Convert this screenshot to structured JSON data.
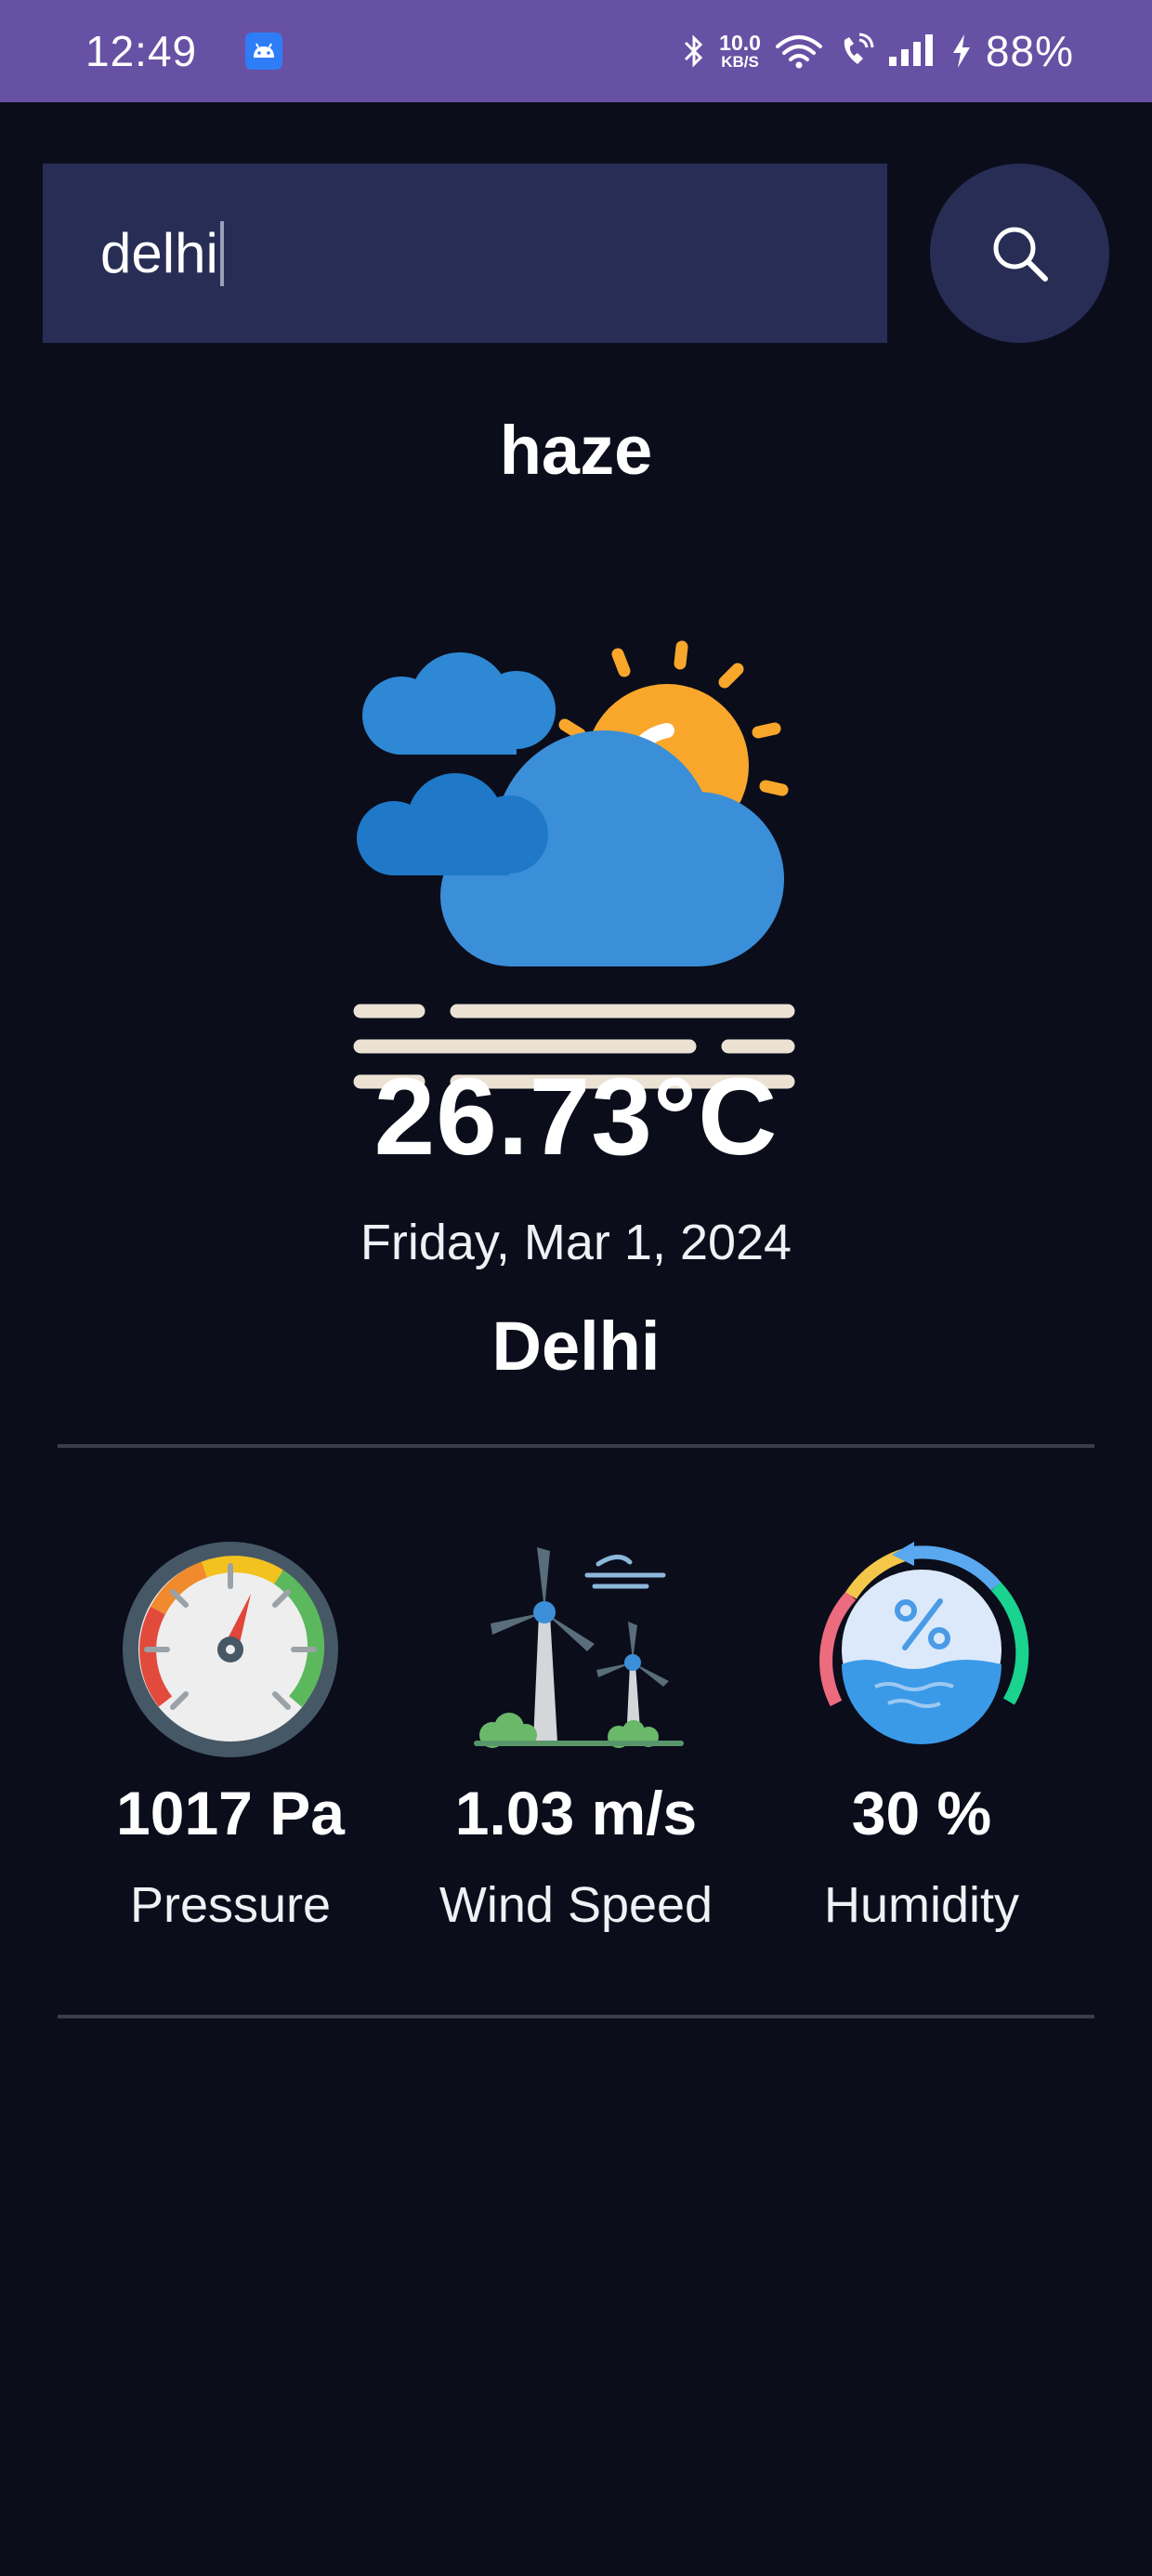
{
  "status_bar": {
    "time": "12:49",
    "net_speed_value": "10.0",
    "net_speed_unit": "KB/S",
    "battery": "88%"
  },
  "search": {
    "value": "delhi"
  },
  "weather": {
    "condition": "haze",
    "temperature": "26.73°C",
    "date": "Friday, Mar 1, 2024",
    "city": "Delhi"
  },
  "stats": {
    "pressure": {
      "value": "1017 Pa",
      "label": "Pressure"
    },
    "wind": {
      "value": "1.03 m/s",
      "label": "Wind Speed"
    },
    "humidity": {
      "value": "30 %",
      "label": "Humidity"
    }
  },
  "colors": {
    "background": "#0b0d1b",
    "status_bar": "#6751a4",
    "input_background": "#272d54",
    "divider": "#3a3d4a"
  }
}
